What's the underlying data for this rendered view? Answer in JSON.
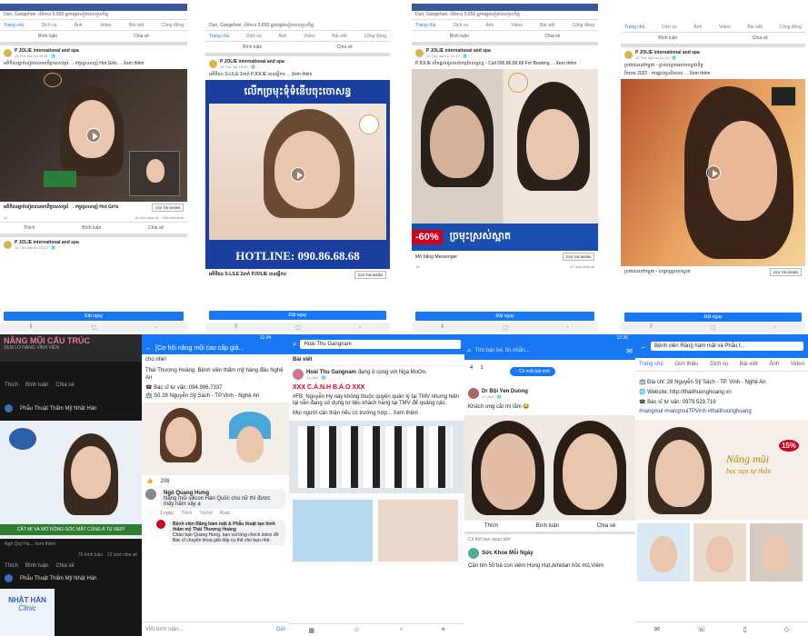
{
  "top": [
    {
      "bar": "Dun, Gangehoe, ព័ត៌មាន 5.650 អ្នកផ្សេងទៀតបានចូលចិត្ត",
      "tabs": [
        "Trang chủ",
        "Dịch vụ",
        "Ảnh",
        "Video",
        "Bài viết",
        "Cộng đồng"
      ],
      "actions": [
        "Bình luận",
        "Chia sẻ"
      ],
      "page": "P JOLIE international and spa",
      "time": "14 Thứ hai lúc 09:41 · 🌐",
      "caption": "អតិថិជនម្នាក់ទៀតបានមកពីប្រទេសកូរ៉េ → #គួរស្រលាញ់ Hot Girls ... Xem thêm",
      "link": "អតិថិជនម្នាក់ទៀតបានមកពីប្រទេសកូរ៉េ → #គួរស្រលាញ់ Hot Girls",
      "linkbtn": "GỌI TIN NHẮN",
      "likes": "12",
      "stats": "16 lượt chia sẻ · 308 lượt xem",
      "act": [
        "Thích",
        "Bình luận",
        "Chia sẻ"
      ],
      "page2": "P JOLIE international and spa",
      "time2": "14 Thứ hai lúc 23:25 · 🌐",
      "book": "Đặt ngay"
    },
    {
      "bar": "Dun, Gangehoe, ព័ត៌មាន 5.650 អ្នកផ្សេងទៀតបានចូលចិត្ត",
      "tabs": [
        "Trang chủ",
        "Dịch vụ",
        "Ảnh",
        "Video",
        "Bài viết",
        "Cộng đồng"
      ],
      "actions": [
        "Bình luận",
        "Chia sẻ"
      ],
      "page": "P JOLIE international and spa",
      "time": "14 Thứ hai 18:30 · 🌐",
      "caption": "អតិថិជន S-LILE 2ពាក់ PJOLIE បានធ្វើការ ... Xem thêm",
      "banner": "លើកច្រមុះទុំទំនើបចុះចោសន្ធ",
      "hotline": "HOTLINE: 090.86.68.68",
      "link": "អតិថិជន S-LILE 2ពាក់ PJOLIE បានធ្វើការ",
      "linkbtn": "GỌI TIN NHẮN",
      "book": "Đặt ngay"
    },
    {
      "bar": "Dun, Gangehoe, ព័ត៌មាន 5.650 អ្នកផ្សេងទៀតបានចូលចិត្ត",
      "tabs": [
        "Trang chủ",
        "Dịch vụ",
        "Ảnh",
        "Video",
        "Bài viết",
        "Cộng đồng"
      ],
      "actions": [
        "Bình luận",
        "Chia sẻ"
      ],
      "page": "P JOLIE international and spa",
      "time": "20 Thứ hai lúc 14:13 · 🌐",
      "caption": "PJOLIE បើកផ្ដល់ជូនសេវាកម្មកែសម្ផស្ស - Call 090.86.68.68 For Booking ... Xem thêm",
      "promo": "-60%",
      "promo_text": "ច្រមុះស្រស់ស្អាត",
      "link": "Mở bằng Messenger",
      "linkbtn": "GỌI TIN NHẮN",
      "likes": "19",
      "stats": "47 lượt chia sẻ",
      "book": "Đặt ngay"
    },
    {
      "tabs": [
        "Trang chủ",
        "Dịch vụ",
        "Ảnh",
        "Video",
        "Bài viết",
        "Cộng đồng"
      ],
      "actions": [
        "Bình luận",
        "Chia sẻ"
      ],
      "page": "P JOLIE international and spa",
      "time": "14 Thứ hai lúc 14:13 · 🌐",
      "caption": "ប្រជាជននៅកម្ពុជា - ស្រស់ស្អាតអស់កល្បជានិច្ច",
      "caption2": "រីករាយ 2022 - ការផ្ដល់ជូនពិសេស ... Xem thêm",
      "link": "ប្រជាជននៅកម្ពុជា - សម្ផស្សស្រស់ស្អាត",
      "linkbtn": "GỌI TIN NHẮN",
      "book": "Đặt ngay"
    }
  ],
  "bottom": [
    {
      "title": "NÂNG MŨI CẤU TRÚC",
      "sub": "XEM LO HÀNG VĨNH VIỄN",
      "act": [
        "Thích",
        "Bình luận",
        "Chia sẻ"
      ],
      "page": "Phẫu Thuật Thẩm Mỹ Nhật Hàn",
      "banner": "CẮT MÍ VÀ MỞ RỘNG GÓC MẮT CÙNG Ả TỰ ĐẸP!",
      "stat": "Ngô Quý Hạ... Xem thêm",
      "stat2": "76 bình luận · 12 lượt chia sẻ",
      "logo": "NHẬT HÀN",
      "clinic": "Clinic"
    },
    {
      "time": "11:34",
      "post": "[Cơ hội nâng mũi cao cấp giá...",
      "sub": "cho nhé!",
      "line1": "Thái Thượng Hoàng: Bệnh viện thẩm mỹ hàng đầu Nghệ An",
      "phone": "☎ Bác sĩ tư vấn: 094.996.7337",
      "addr": "🏥 Số 28 Nguyễn Sỹ Sách - TP.Vinh - Nghệ An",
      "likes": "208",
      "commenter": "Ngô Quang Hưng",
      "comment": "Nâng mũi silicon Hàn Quốc cho nữ thì được mấy năm vậy ạ",
      "ctime": "1 ngày",
      "cacts": [
        "Thích",
        "Trả lời",
        "Khác"
      ],
      "reply_name": "Bệnh viện Răng hàm mặt & Phẫu thuật tạo hình thẩm mỹ Thái Thượng Hoàng",
      "reply": "Chào bạn Quang Hưng, bạn vui lòng check inbox để Bác sĩ chuyên khoa giải đáp cụ thể cho bạn nhé.",
      "input": "Viết bình luận...",
      "send": "Gửi"
    },
    {
      "search": "Hoài Thu Gangnam",
      "label": "Bài viết",
      "name": "Hoài Thu Gangnam",
      "action": "đang ở cùng với Nga MoOn.",
      "time": "12 phút · 🌐",
      "warn": "XXX C.Á.N.H B.Á.O XXX",
      "body": "#FB: Nguyễn Hy này không thuộc quyền quản lý tại TMV nhưng hiện tại vẫn đang sử dụng tư liệu khách hàng tại TMV để quảng cáo.",
      "more": "Mọi người cần thận nếu có trường hợp... Xem thêm"
    },
    {
      "time": "12:36",
      "search": "Tìm bạn bè, tin nhắn...",
      "reacts": "4",
      "comments": "1",
      "newpost": "↑ Có một bài mới",
      "name": "Dr Bội Yen Duong",
      "age": "41 phút · 🌐",
      "body": "Khách ưng cắt mí lắm 😂",
      "act": [
        "Thích",
        "Bình luận",
        "Chia sẻ"
      ],
      "know": "Có thể bạn quan tâm",
      "page": "Sức Khỏe Mỗi Ngày",
      "body2": "Cần tìm 50 bà con viêm Họng Hạt,Amidan hốc mủ,Viêm"
    },
    {
      "search": "Bệnh viện Răng hàm mặt và Phẫu t...",
      "tabs": [
        "Trang chủ",
        "Giới thiệu",
        "Dịch vụ",
        "Bài viết",
        "Ảnh",
        "Video"
      ],
      "addr": "🏥 Địa chỉ: 28 Nguyễn Sỹ Sách - TP. Vinh - Nghệ An",
      "web": "🌐 Website: http://thaithuonghoang.vn",
      "phone": "☎ Bác sĩ tư vấn: 0979.529.719",
      "tags": "#nangmui #nangmuiTPVinh #thaithuonghoang",
      "brand": "Nâng mũi",
      "brand2": "bọc sụn tự thân",
      "badge": "15%"
    }
  ],
  "colors": {
    "fb": "#1877f2",
    "fbdark": "#3b5998",
    "accent": "#d0021b"
  }
}
